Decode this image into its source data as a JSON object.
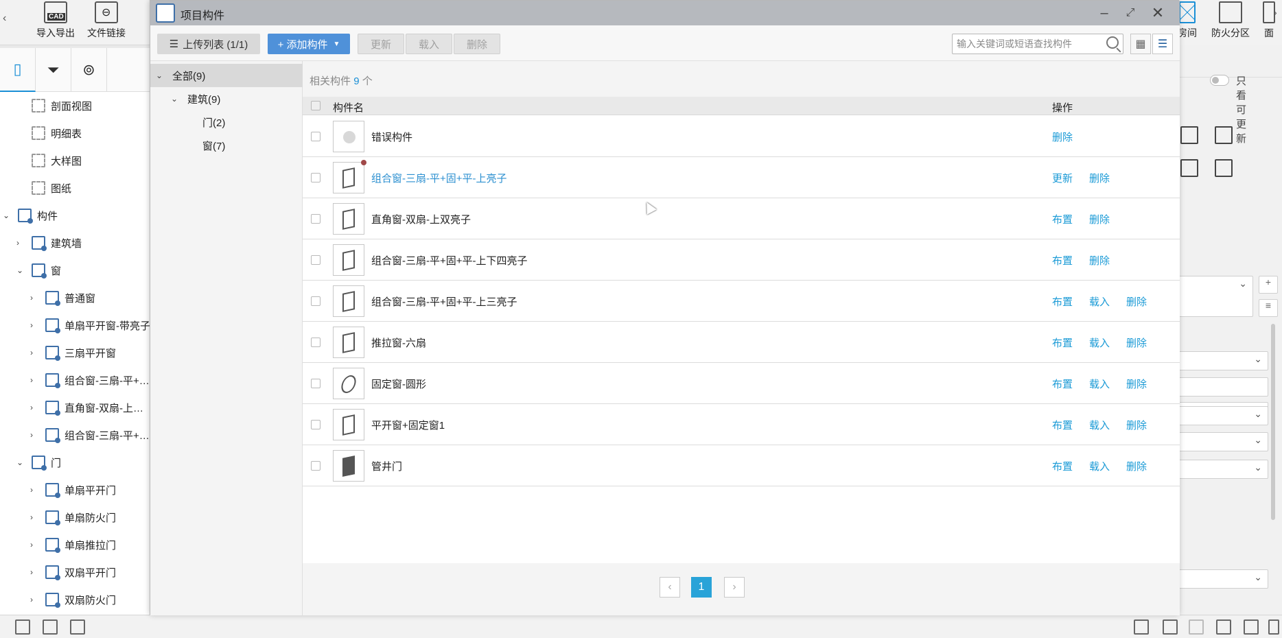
{
  "ribbon": {
    "buttons": [
      "导入导出",
      "文件链接"
    ],
    "right_buttons": [
      "房间",
      "防火分区",
      "面"
    ]
  },
  "left_tree": [
    {
      "label": "剖面视图",
      "indent": 1,
      "chev": "",
      "icon": "plain"
    },
    {
      "label": "明细表",
      "indent": 1,
      "chev": "",
      "icon": "plain"
    },
    {
      "label": "大样图",
      "indent": 1,
      "chev": "",
      "icon": "plain"
    },
    {
      "label": "图纸",
      "indent": 1,
      "chev": "",
      "icon": "plain"
    },
    {
      "label": "构件",
      "indent": 0,
      "chev": "⌄",
      "icon": "comp"
    },
    {
      "label": "建筑墙",
      "indent": 1,
      "chev": "›",
      "icon": "comp"
    },
    {
      "label": "窗",
      "indent": 1,
      "chev": "⌄",
      "icon": "comp"
    },
    {
      "label": "普通窗",
      "indent": 2,
      "chev": "›",
      "icon": "comp"
    },
    {
      "label": "单扇平开窗-带亮子",
      "indent": 2,
      "chev": "›",
      "icon": "comp"
    },
    {
      "label": "三扇平开窗",
      "indent": 2,
      "chev": "›",
      "icon": "comp"
    },
    {
      "label": "组合窗-三扇-平+…",
      "indent": 2,
      "chev": "›",
      "icon": "comp"
    },
    {
      "label": "直角窗-双扇-上…",
      "indent": 2,
      "chev": "›",
      "icon": "comp"
    },
    {
      "label": "组合窗-三扇-平+…",
      "indent": 2,
      "chev": "›",
      "icon": "comp"
    },
    {
      "label": "门",
      "indent": 1,
      "chev": "⌄",
      "icon": "comp"
    },
    {
      "label": "单扇平开门",
      "indent": 2,
      "chev": "›",
      "icon": "comp"
    },
    {
      "label": "单扇防火门",
      "indent": 2,
      "chev": "›",
      "icon": "comp"
    },
    {
      "label": "单扇推拉门",
      "indent": 2,
      "chev": "›",
      "icon": "comp"
    },
    {
      "label": "双扇平开门",
      "indent": 2,
      "chev": "›",
      "icon": "comp"
    },
    {
      "label": "双扇防火门",
      "indent": 2,
      "chev": "›",
      "icon": "comp"
    }
  ],
  "dialog": {
    "title": "项目构件",
    "toolbar": {
      "upload": "上传列表 (1/1)",
      "add": "+ 添加构件",
      "update": "更新",
      "load": "载入",
      "delete": "删除",
      "search_placeholder": "输入关键词或短语查找构件"
    },
    "tree": [
      {
        "label": "全部(9)",
        "chev": "⌄",
        "indent": 0,
        "selected": true
      },
      {
        "label": "建筑(9)",
        "chev": "⌄",
        "indent": 1,
        "selected": false
      },
      {
        "label": "门(2)",
        "chev": "",
        "indent": 2,
        "selected": false
      },
      {
        "label": "窗(7)",
        "chev": "",
        "indent": 2,
        "selected": false
      }
    ],
    "info": {
      "prefix": "相关构件",
      "count": "9",
      "suffix": "个",
      "toggle_label": "只看可更新"
    },
    "columns": {
      "name": "构件名",
      "ops": "操作"
    },
    "rows": [
      {
        "name": "错误构件",
        "thumb": "err",
        "link": false,
        "dot": false,
        "ops": [
          "删除"
        ]
      },
      {
        "name": "组合窗-三扇-平+固+平-上亮子",
        "thumb": "win",
        "link": true,
        "dot": true,
        "ops": [
          "更新",
          "删除"
        ]
      },
      {
        "name": "直角窗-双扇-上双亮子",
        "thumb": "win",
        "link": false,
        "dot": false,
        "ops": [
          "布置",
          "删除"
        ]
      },
      {
        "name": "组合窗-三扇-平+固+平-上下四亮子",
        "thumb": "win",
        "link": false,
        "dot": false,
        "ops": [
          "布置",
          "删除"
        ]
      },
      {
        "name": "组合窗-三扇-平+固+平-上三亮子",
        "thumb": "win",
        "link": false,
        "dot": false,
        "ops": [
          "布置",
          "载入",
          "删除"
        ]
      },
      {
        "name": "推拉窗-六扇",
        "thumb": "win",
        "link": false,
        "dot": false,
        "ops": [
          "布置",
          "载入",
          "删除"
        ]
      },
      {
        "name": "固定窗-圆形",
        "thumb": "circ",
        "link": false,
        "dot": false,
        "ops": [
          "布置",
          "载入",
          "删除"
        ]
      },
      {
        "name": "平开窗+固定窗1",
        "thumb": "win",
        "link": false,
        "dot": false,
        "ops": [
          "布置",
          "载入",
          "删除"
        ]
      },
      {
        "name": "管井门",
        "thumb": "door",
        "link": false,
        "dot": false,
        "ops": [
          "布置",
          "载入",
          "删除"
        ]
      }
    ],
    "pager": {
      "prev": "‹",
      "current": "1",
      "next": "›"
    }
  },
  "colors": {
    "accent": "#1a9ad6",
    "add_button": "#4f91d9",
    "page_current": "#29a3d8",
    "title_bar": "#b6b9be"
  }
}
